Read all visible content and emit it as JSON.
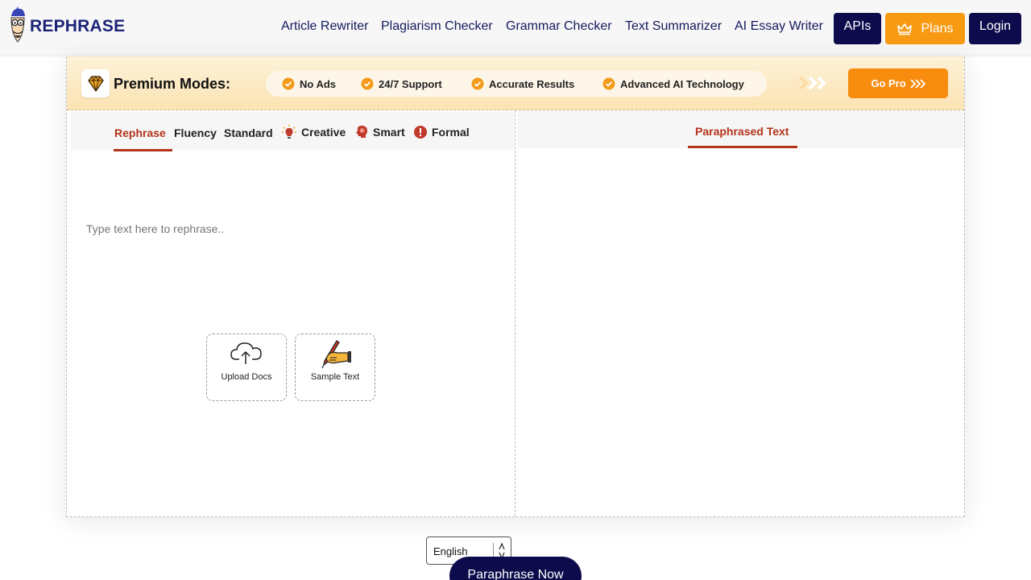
{
  "brand": {
    "name": "REPHRASE"
  },
  "nav": {
    "items": [
      "Article Rewriter",
      "Plagiarism Checker",
      "Grammar Checker",
      "Text Summarizer",
      "AI Essay Writer"
    ],
    "apis_label": "APIs",
    "plans_label": "Plans",
    "login_label": "Login"
  },
  "promo": {
    "title": "Premium Modes:",
    "features": [
      "No Ads",
      "24/7 Support",
      "Accurate Results",
      "Advanced AI Technology"
    ],
    "cta_label": "Go Pro"
  },
  "modes": {
    "tabs": [
      "Rephrase",
      "Fluency",
      "Standard",
      "Creative",
      "Smart",
      "Formal"
    ],
    "active": "Rephrase"
  },
  "editor": {
    "placeholder": "Type text here to rephrase..",
    "upload_label": "Upload Docs",
    "sample_label": "Sample Text",
    "language": "English"
  },
  "output": {
    "tab_label": "Paraphrased Text"
  },
  "actions": {
    "paraphrase_label": "Paraphrase Now"
  },
  "colors": {
    "navy": "#0d0b4b",
    "orange": "#f89a12",
    "accent_red": "#b5331a"
  }
}
